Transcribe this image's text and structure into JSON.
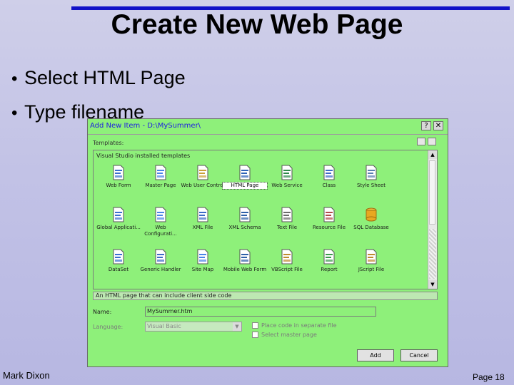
{
  "slide": {
    "title": "Create New Web Page",
    "bullets": [
      "Select HTML Page",
      "Type filename"
    ],
    "footer_left": "Mark Dixon",
    "footer_right": "Page 18",
    "accent": "#1010c8"
  },
  "dialog": {
    "title": "Add New Item - D:\\MySummer\\",
    "help_button": "?",
    "close_button": "✕",
    "templates_label": "Templates:",
    "installed_header": "Visual Studio installed templates",
    "templates": [
      {
        "label": "Web Form",
        "icon": "web-form-icon",
        "selected": false
      },
      {
        "label": "Master Page",
        "icon": "master-page-icon",
        "selected": false
      },
      {
        "label": "Web User Control",
        "icon": "web-user-control-icon",
        "selected": false
      },
      {
        "label": "HTML Page",
        "icon": "html-page-icon",
        "selected": true
      },
      {
        "label": "Web Service",
        "icon": "web-service-icon",
        "selected": false
      },
      {
        "label": "Class",
        "icon": "class-icon",
        "selected": false
      },
      {
        "label": "Style Sheet",
        "icon": "style-sheet-icon",
        "selected": false
      },
      {
        "label": "Global Applicati...",
        "icon": "global-application-icon",
        "selected": false
      },
      {
        "label": "Web Configurati...",
        "icon": "web-configuration-icon",
        "selected": false
      },
      {
        "label": "XML File",
        "icon": "xml-file-icon",
        "selected": false
      },
      {
        "label": "XML Schema",
        "icon": "xml-schema-icon",
        "selected": false
      },
      {
        "label": "Text File",
        "icon": "text-file-icon",
        "selected": false
      },
      {
        "label": "Resource File",
        "icon": "resource-file-icon",
        "selected": false
      },
      {
        "label": "SQL Database",
        "icon": "sql-database-icon",
        "selected": false
      },
      {
        "label": "DataSet",
        "icon": "dataset-icon",
        "selected": false
      },
      {
        "label": "Generic Handler",
        "icon": "generic-handler-icon",
        "selected": false
      },
      {
        "label": "Site Map",
        "icon": "site-map-icon",
        "selected": false
      },
      {
        "label": "Mobile Web Form",
        "icon": "mobile-web-form-icon",
        "selected": false
      },
      {
        "label": "VBScript File",
        "icon": "vbscript-file-icon",
        "selected": false
      },
      {
        "label": "Report",
        "icon": "report-icon",
        "selected": false
      },
      {
        "label": "JScript File",
        "icon": "jscript-file-icon",
        "selected": false
      }
    ],
    "description": "An HTML page that can include client side code",
    "name_label": "Name:",
    "name_value": "MySummer.htm",
    "language_label": "Language:",
    "language_value": "Visual Basic",
    "place_code_label": "Place code in separate file",
    "select_master_label": "Select master page",
    "add_button": "Add",
    "cancel_button": "Cancel",
    "bg_color": "#8ef07a"
  }
}
